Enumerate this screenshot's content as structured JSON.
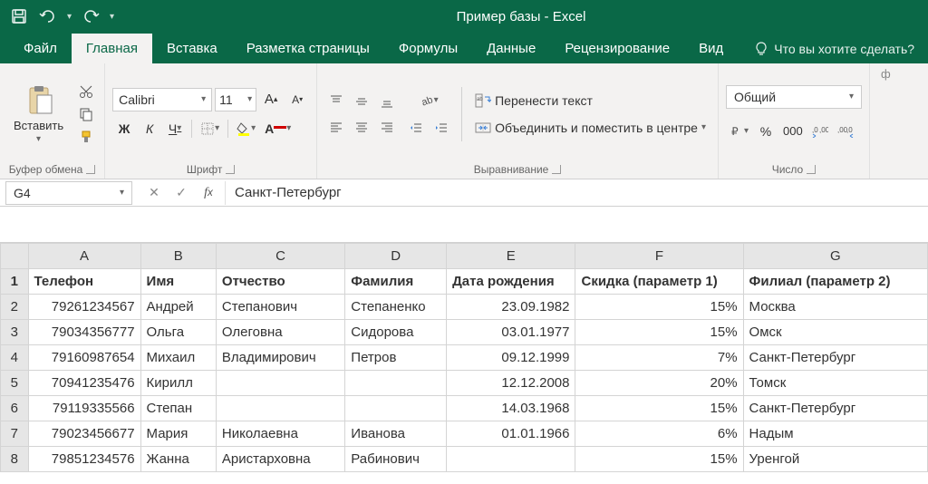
{
  "title": "Пример базы - Excel",
  "tabs": {
    "file": "Файл",
    "home": "Главная",
    "insert": "Вставка",
    "layout": "Разметка страницы",
    "formulas": "Формулы",
    "data": "Данные",
    "review": "Рецензирование",
    "view": "Вид"
  },
  "tell_me": "Что вы хотите сделать?",
  "ribbon": {
    "clipboard": {
      "label": "Буфер обмена",
      "paste": "Вставить"
    },
    "font": {
      "label": "Шрифт",
      "name": "Calibri",
      "size": "11",
      "bold": "Ж",
      "italic": "К",
      "underline": "Ч"
    },
    "alignment": {
      "label": "Выравнивание",
      "wrap": "Перенести текст",
      "merge": "Объединить и поместить в центре"
    },
    "number": {
      "label": "Число",
      "format": "Общий"
    }
  },
  "name_box": "G4",
  "formula_value": "Санкт-Петербург",
  "columns": [
    "A",
    "B",
    "C",
    "D",
    "E",
    "F",
    "G"
  ],
  "headers": [
    "Телефон",
    "Имя",
    "Отчество",
    "Фамилия",
    "Дата рождения",
    "Скидка (параметр 1)",
    "Филиал (параметр 2)"
  ],
  "rows": [
    [
      "79261234567",
      "Андрей",
      "Степанович",
      "Степаненко",
      "23.09.1982",
      "15%",
      "Москва"
    ],
    [
      "79034356777",
      "Ольга",
      "Олеговна",
      "Сидорова",
      "03.01.1977",
      "15%",
      "Омск"
    ],
    [
      "79160987654",
      "Михаил",
      "Владимирович",
      "Петров",
      "09.12.1999",
      "7%",
      "Санкт-Петербург"
    ],
    [
      "70941235476",
      "Кирилл",
      "",
      "",
      "12.12.2008",
      "20%",
      "Томск"
    ],
    [
      "79119335566",
      "Степан",
      "",
      "",
      "14.03.1968",
      "15%",
      "Санкт-Петербург"
    ],
    [
      "79023456677",
      "Мария",
      "Николаевна",
      "Иванова",
      "01.01.1966",
      "6%",
      "Надым"
    ],
    [
      "79851234576",
      "Жанна",
      "Аристарховна",
      "Рабинович",
      "",
      "15%",
      "Уренгой"
    ]
  ]
}
